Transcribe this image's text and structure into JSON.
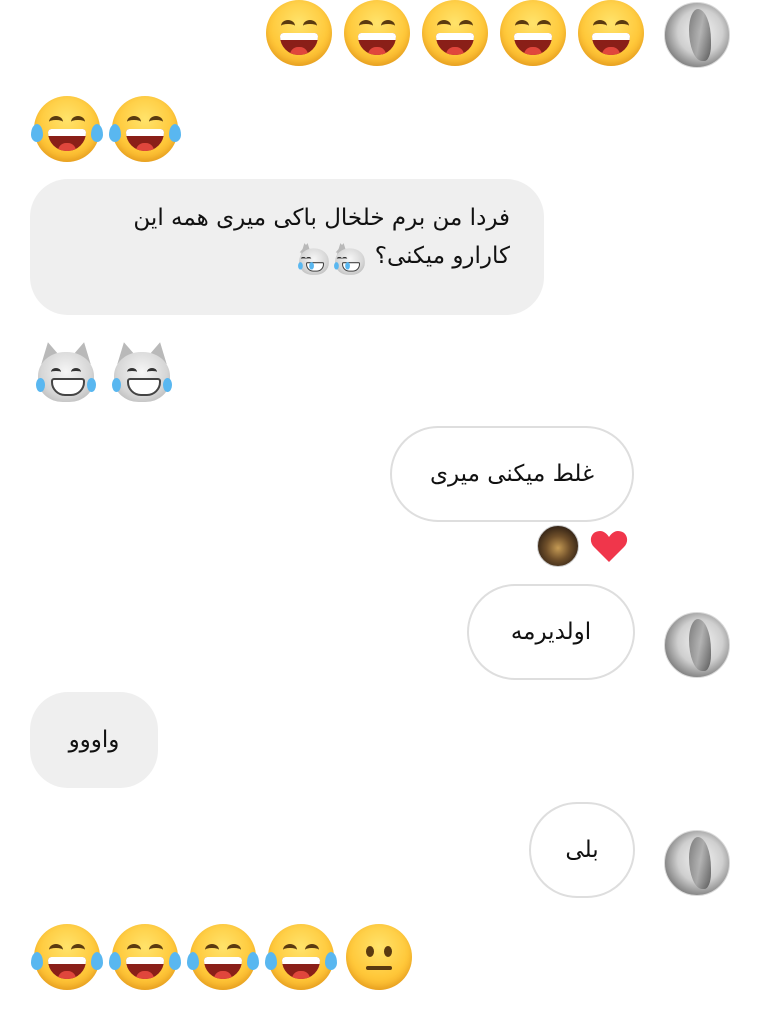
{
  "messages": {
    "m1_text": "فردا من برم خلخال باکی میری همه این کارارو میکنی؟",
    "m2_text": "غلط میکنی میری",
    "m3_text": "اولدیرمه",
    "m4_text": "واووو",
    "m5_text": "بلی"
  },
  "emoji": {
    "row1": [
      "grinning-sweat",
      "grinning-sweat",
      "grinning-sweat",
      "grinning-sweat",
      "grinning-sweat"
    ],
    "row2": [
      "joy",
      "joy"
    ],
    "row3": [
      "cat-joy",
      "cat-joy"
    ],
    "row_last": [
      "joy",
      "joy",
      "joy",
      "joy",
      "neutral"
    ]
  },
  "reactions": {
    "m2": [
      "heart-icon"
    ]
  },
  "colors": {
    "heart": "#f0364b",
    "incoming_bubble": "#efefef",
    "outgoing_border": "#dedede"
  }
}
